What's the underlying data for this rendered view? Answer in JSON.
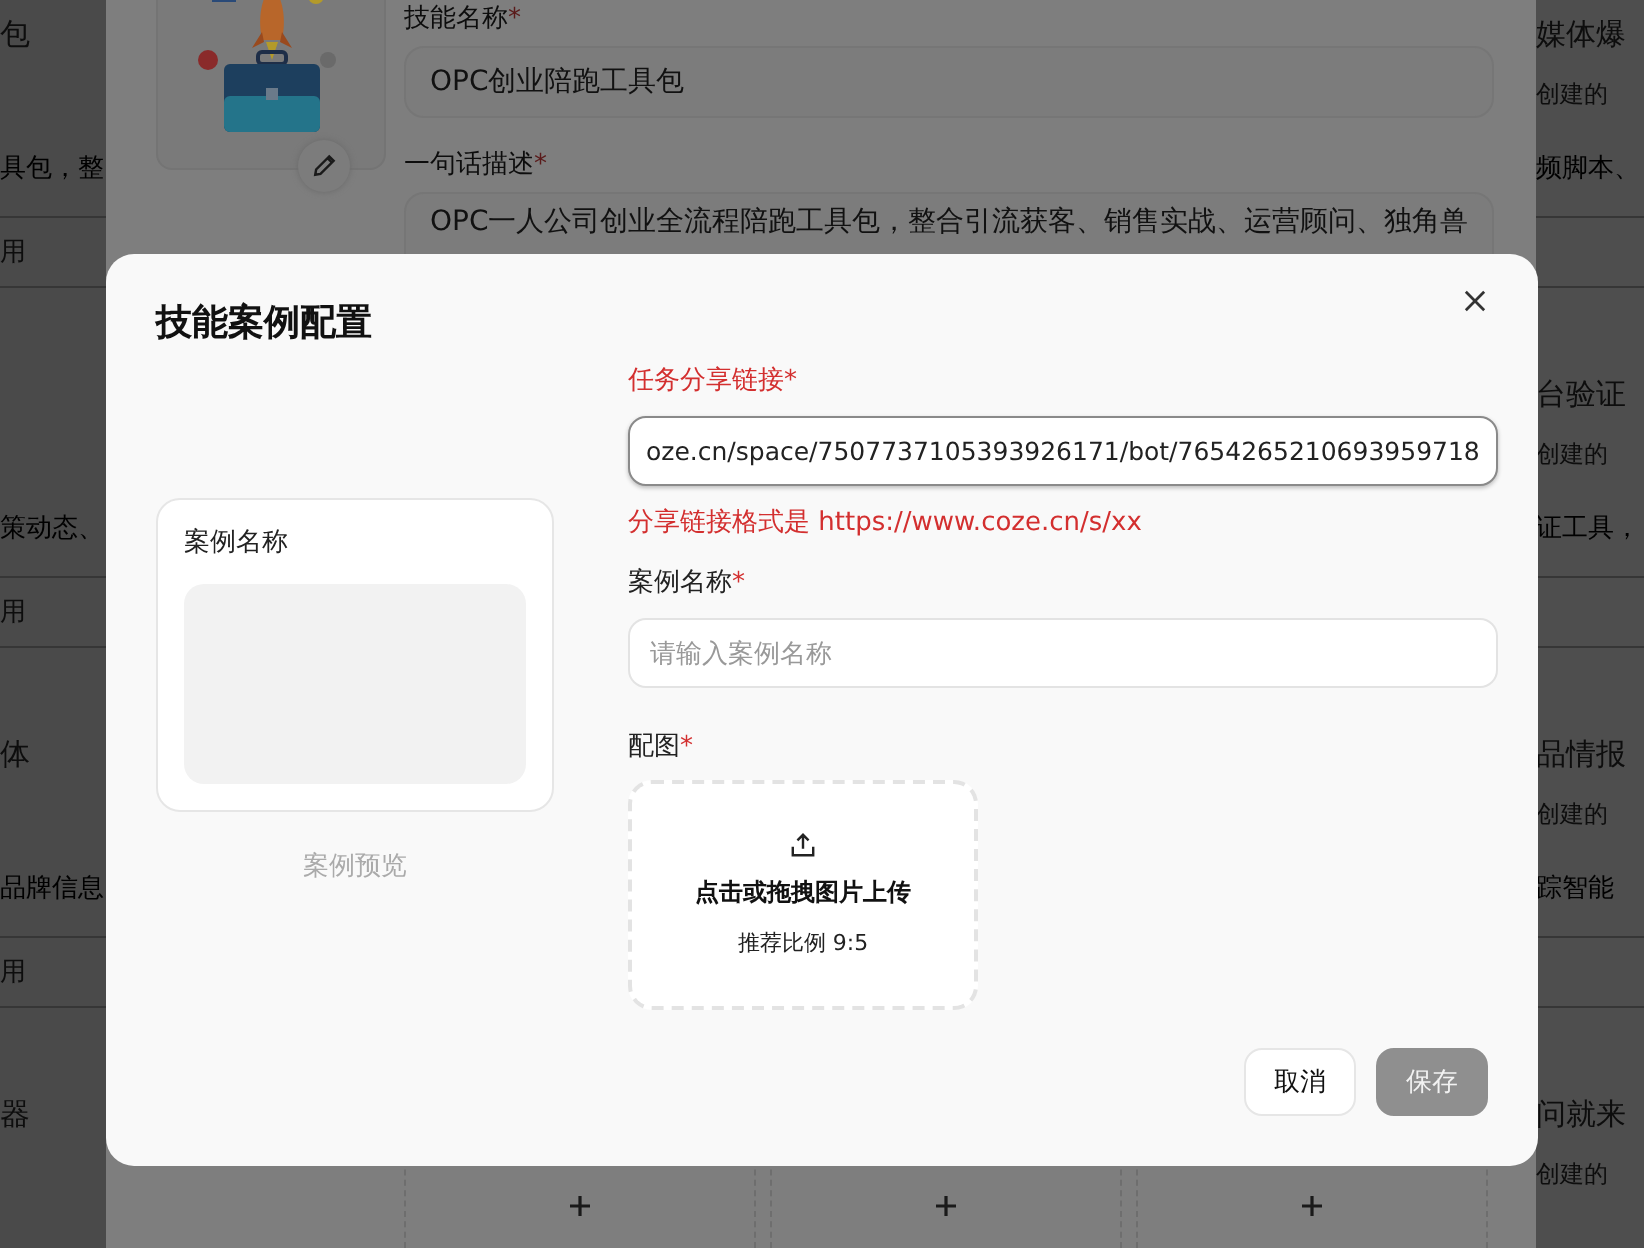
{
  "background_page": {
    "left_cards": [
      {
        "title": "包",
        "description": "具包，整",
        "action": "用"
      },
      {
        "description": "策动态、",
        "action": "用"
      },
      {
        "title": "体",
        "description": "品牌信息",
        "action": "用"
      },
      {
        "title": "器"
      }
    ],
    "right_cards": [
      {
        "title": "媒体爆",
        "creator": "创建的",
        "description": "频脚本、"
      },
      {
        "title": "台验证",
        "creator": "创建的",
        "description": "证工具，"
      },
      {
        "title": "品情报",
        "creator": "创建的",
        "description": "踪智能"
      },
      {
        "title": "问就来",
        "creator": "创建的"
      }
    ]
  },
  "skill_editor": {
    "name_label": "技能名称",
    "name_required_mark": "*",
    "name_value": "OPC创业陪跑工具包",
    "description_label": "一句话描述",
    "description_required_mark": "*",
    "description_value": "OPC一人公司创业全流程陪跑工具包，整合引流获客、销售实战、运营顾问、独角兽"
  },
  "dialog": {
    "title": "技能案例配置",
    "preview": {
      "card_title": "案例名称",
      "caption": "案例预览"
    },
    "fields": [
      {
        "kind": "text",
        "label": "任务分享链接",
        "required_mark": "*",
        "value": "oze.cn/space/7507737105393926171/bot/7654265210693959718",
        "error": "分享链接格式是 https://www.coze.cn/s/xx"
      },
      {
        "kind": "text",
        "label": "案例名称",
        "required_mark": "*",
        "placeholder": "请输入案例名称"
      },
      {
        "kind": "upload",
        "label": "配图",
        "required_mark": "*",
        "prompt": "点击或拖拽图片上传",
        "hint": "推荐比例 9:5"
      }
    ],
    "buttons": [
      {
        "label": "取消",
        "primary": false,
        "disabled": false
      },
      {
        "label": "保存",
        "primary": true,
        "disabled": true
      }
    ]
  }
}
